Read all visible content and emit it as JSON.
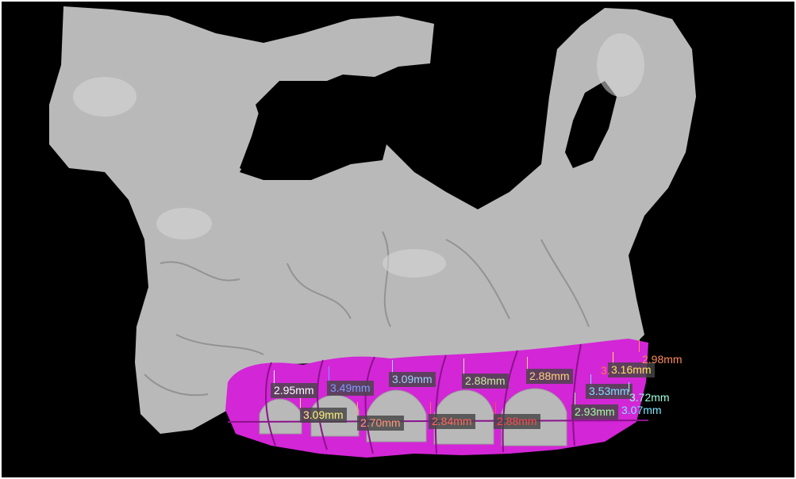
{
  "view": {
    "bone_color": "#b9b9b9",
    "guide_color": "#d326d6",
    "background": "#000000"
  },
  "measurements": [
    {
      "text": "2.95mm",
      "color": "#ffffff"
    },
    {
      "text": "3.49mm",
      "color": "#7b9cff"
    },
    {
      "text": "3.09mm",
      "color": "#9ad4ff"
    },
    {
      "text": "2.88mm",
      "color": "#c8f0a0"
    },
    {
      "text": "2.88mm",
      "color": "#ffd27a"
    },
    {
      "text": "3.09mm",
      "color": "#fff07a"
    },
    {
      "text": "2.70mm",
      "color": "#ff9a7a"
    },
    {
      "text": "2.84mm",
      "color": "#ff6a5a"
    },
    {
      "text": "2.88mm",
      "color": "#ff4a4a"
    },
    {
      "text": "2.93mm",
      "color": "#a0ffa0"
    },
    {
      "text": "3.53mm",
      "color": "#7ae0ff"
    },
    {
      "text": "3.16mm",
      "color": "#ffe060"
    },
    {
      "text": "3.",
      "color": "#ff7a4a"
    },
    {
      "text": "2.98mm",
      "color": "#ff8a5a"
    },
    {
      "text": "3.72mm",
      "color": "#a0ffe0"
    },
    {
      "text": "3.07mm",
      "color": "#7ae8ff"
    }
  ]
}
